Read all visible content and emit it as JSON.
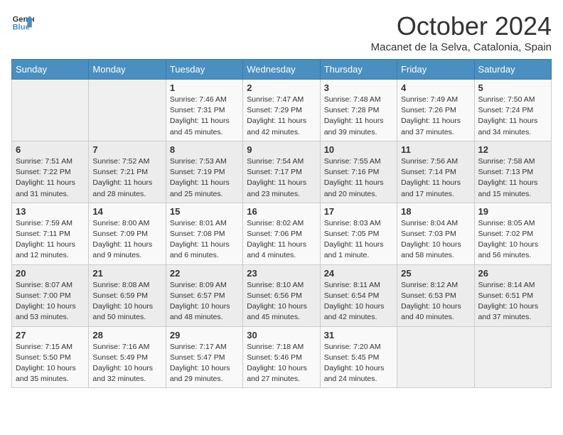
{
  "header": {
    "logo_line1": "General",
    "logo_line2": "Blue",
    "month": "October 2024",
    "location": "Macanet de la Selva, Catalonia, Spain"
  },
  "days_of_week": [
    "Sunday",
    "Monday",
    "Tuesday",
    "Wednesday",
    "Thursday",
    "Friday",
    "Saturday"
  ],
  "weeks": [
    [
      {
        "day": "",
        "sunrise": "",
        "sunset": "",
        "daylight": ""
      },
      {
        "day": "",
        "sunrise": "",
        "sunset": "",
        "daylight": ""
      },
      {
        "day": "1",
        "sunrise": "Sunrise: 7:46 AM",
        "sunset": "Sunset: 7:31 PM",
        "daylight": "Daylight: 11 hours and 45 minutes."
      },
      {
        "day": "2",
        "sunrise": "Sunrise: 7:47 AM",
        "sunset": "Sunset: 7:29 PM",
        "daylight": "Daylight: 11 hours and 42 minutes."
      },
      {
        "day": "3",
        "sunrise": "Sunrise: 7:48 AM",
        "sunset": "Sunset: 7:28 PM",
        "daylight": "Daylight: 11 hours and 39 minutes."
      },
      {
        "day": "4",
        "sunrise": "Sunrise: 7:49 AM",
        "sunset": "Sunset: 7:26 PM",
        "daylight": "Daylight: 11 hours and 37 minutes."
      },
      {
        "day": "5",
        "sunrise": "Sunrise: 7:50 AM",
        "sunset": "Sunset: 7:24 PM",
        "daylight": "Daylight: 11 hours and 34 minutes."
      }
    ],
    [
      {
        "day": "6",
        "sunrise": "Sunrise: 7:51 AM",
        "sunset": "Sunset: 7:22 PM",
        "daylight": "Daylight: 11 hours and 31 minutes."
      },
      {
        "day": "7",
        "sunrise": "Sunrise: 7:52 AM",
        "sunset": "Sunset: 7:21 PM",
        "daylight": "Daylight: 11 hours and 28 minutes."
      },
      {
        "day": "8",
        "sunrise": "Sunrise: 7:53 AM",
        "sunset": "Sunset: 7:19 PM",
        "daylight": "Daylight: 11 hours and 25 minutes."
      },
      {
        "day": "9",
        "sunrise": "Sunrise: 7:54 AM",
        "sunset": "Sunset: 7:17 PM",
        "daylight": "Daylight: 11 hours and 23 minutes."
      },
      {
        "day": "10",
        "sunrise": "Sunrise: 7:55 AM",
        "sunset": "Sunset: 7:16 PM",
        "daylight": "Daylight: 11 hours and 20 minutes."
      },
      {
        "day": "11",
        "sunrise": "Sunrise: 7:56 AM",
        "sunset": "Sunset: 7:14 PM",
        "daylight": "Daylight: 11 hours and 17 minutes."
      },
      {
        "day": "12",
        "sunrise": "Sunrise: 7:58 AM",
        "sunset": "Sunset: 7:13 PM",
        "daylight": "Daylight: 11 hours and 15 minutes."
      }
    ],
    [
      {
        "day": "13",
        "sunrise": "Sunrise: 7:59 AM",
        "sunset": "Sunset: 7:11 PM",
        "daylight": "Daylight: 11 hours and 12 minutes."
      },
      {
        "day": "14",
        "sunrise": "Sunrise: 8:00 AM",
        "sunset": "Sunset: 7:09 PM",
        "daylight": "Daylight: 11 hours and 9 minutes."
      },
      {
        "day": "15",
        "sunrise": "Sunrise: 8:01 AM",
        "sunset": "Sunset: 7:08 PM",
        "daylight": "Daylight: 11 hours and 6 minutes."
      },
      {
        "day": "16",
        "sunrise": "Sunrise: 8:02 AM",
        "sunset": "Sunset: 7:06 PM",
        "daylight": "Daylight: 11 hours and 4 minutes."
      },
      {
        "day": "17",
        "sunrise": "Sunrise: 8:03 AM",
        "sunset": "Sunset: 7:05 PM",
        "daylight": "Daylight: 11 hours and 1 minute."
      },
      {
        "day": "18",
        "sunrise": "Sunrise: 8:04 AM",
        "sunset": "Sunset: 7:03 PM",
        "daylight": "Daylight: 10 hours and 58 minutes."
      },
      {
        "day": "19",
        "sunrise": "Sunrise: 8:05 AM",
        "sunset": "Sunset: 7:02 PM",
        "daylight": "Daylight: 10 hours and 56 minutes."
      }
    ],
    [
      {
        "day": "20",
        "sunrise": "Sunrise: 8:07 AM",
        "sunset": "Sunset: 7:00 PM",
        "daylight": "Daylight: 10 hours and 53 minutes."
      },
      {
        "day": "21",
        "sunrise": "Sunrise: 8:08 AM",
        "sunset": "Sunset: 6:59 PM",
        "daylight": "Daylight: 10 hours and 50 minutes."
      },
      {
        "day": "22",
        "sunrise": "Sunrise: 8:09 AM",
        "sunset": "Sunset: 6:57 PM",
        "daylight": "Daylight: 10 hours and 48 minutes."
      },
      {
        "day": "23",
        "sunrise": "Sunrise: 8:10 AM",
        "sunset": "Sunset: 6:56 PM",
        "daylight": "Daylight: 10 hours and 45 minutes."
      },
      {
        "day": "24",
        "sunrise": "Sunrise: 8:11 AM",
        "sunset": "Sunset: 6:54 PM",
        "daylight": "Daylight: 10 hours and 42 minutes."
      },
      {
        "day": "25",
        "sunrise": "Sunrise: 8:12 AM",
        "sunset": "Sunset: 6:53 PM",
        "daylight": "Daylight: 10 hours and 40 minutes."
      },
      {
        "day": "26",
        "sunrise": "Sunrise: 8:14 AM",
        "sunset": "Sunset: 6:51 PM",
        "daylight": "Daylight: 10 hours and 37 minutes."
      }
    ],
    [
      {
        "day": "27",
        "sunrise": "Sunrise: 7:15 AM",
        "sunset": "Sunset: 5:50 PM",
        "daylight": "Daylight: 10 hours and 35 minutes."
      },
      {
        "day": "28",
        "sunrise": "Sunrise: 7:16 AM",
        "sunset": "Sunset: 5:49 PM",
        "daylight": "Daylight: 10 hours and 32 minutes."
      },
      {
        "day": "29",
        "sunrise": "Sunrise: 7:17 AM",
        "sunset": "Sunset: 5:47 PM",
        "daylight": "Daylight: 10 hours and 29 minutes."
      },
      {
        "day": "30",
        "sunrise": "Sunrise: 7:18 AM",
        "sunset": "Sunset: 5:46 PM",
        "daylight": "Daylight: 10 hours and 27 minutes."
      },
      {
        "day": "31",
        "sunrise": "Sunrise: 7:20 AM",
        "sunset": "Sunset: 5:45 PM",
        "daylight": "Daylight: 10 hours and 24 minutes."
      },
      {
        "day": "",
        "sunrise": "",
        "sunset": "",
        "daylight": ""
      },
      {
        "day": "",
        "sunrise": "",
        "sunset": "",
        "daylight": ""
      }
    ]
  ]
}
